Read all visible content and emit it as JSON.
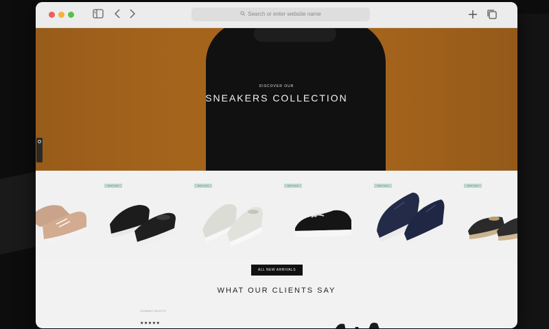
{
  "browser": {
    "address_placeholder": "Search or enter website name",
    "icons": [
      "sidebar-icon",
      "back-icon",
      "forward-icon",
      "new-tab-icon",
      "tabs-overview-icon",
      "search-icon"
    ]
  },
  "hero": {
    "kicker": "DISCOVER OUR",
    "title": "SNEAKERS COLLECTION",
    "background_color": "#a5641c"
  },
  "side_tab": {
    "label": "Comments"
  },
  "products": [
    {
      "badge": "",
      "color": "#c9a48a"
    },
    {
      "badge": "BEST SALE",
      "color": "#1c1c1c"
    },
    {
      "badge": "BEST SALE",
      "color": "#dcdcd6"
    },
    {
      "badge": "BEST SALE",
      "color": "#151515"
    },
    {
      "badge": "BEST SALE",
      "color": "#222a48"
    },
    {
      "badge": "BEST SALE",
      "color": "#2a2a2a"
    }
  ],
  "cta": {
    "label": "ALL NEW ARRIVALS"
  },
  "testimonials": {
    "title": "WHAT OUR CLIENTS SAY",
    "product_label": "COMBAT BOOTS",
    "rating": "★★★★★"
  }
}
